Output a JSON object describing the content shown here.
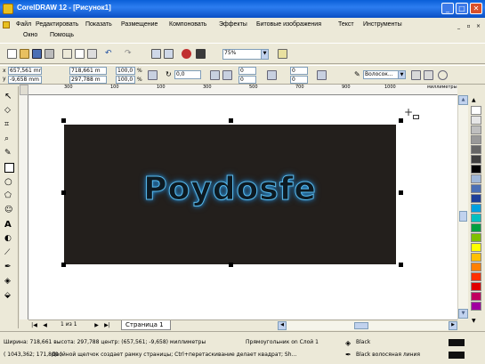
{
  "window": {
    "title": "CorelDRAW 12 - [Рисунок1]"
  },
  "menu": {
    "row1": [
      "Файл",
      "Редактировать",
      "Показать",
      "Размещение",
      "Компоновать",
      "Эффекты",
      "Битовые изображения",
      "Текст",
      "Инструменты"
    ],
    "row2": [
      "Окно",
      "Помощь"
    ]
  },
  "toolbar": {
    "zoom_value": "75%"
  },
  "property_bar": {
    "x_value": "657,561 mm",
    "y_value": "-9,658 mm",
    "width_value": "718,661 m",
    "height_value": "297,788 m",
    "scale_x": "100,0",
    "scale_y": "100,0",
    "scale_unit": "%",
    "rotation": "0,0",
    "corner_1": "0",
    "corner_2": "0",
    "corner_3": "0",
    "corner_4": "0",
    "outline_width": "Волосок..."
  },
  "ruler": {
    "h_labels": [
      "300",
      "200",
      "100",
      "0",
      "100",
      "200",
      "300",
      "400",
      "500",
      "600",
      "700",
      "800",
      "900",
      "1000"
    ],
    "unit": "миллиметры"
  },
  "canvas": {
    "logo_text": "Poydosfe"
  },
  "pagenav": {
    "page_count": "1 из 1",
    "page_tab": "Страница 1"
  },
  "palette": {
    "colors": [
      "#ffffff",
      "#e6e6e6",
      "#bfbfbf",
      "#999999",
      "#666666",
      "#404040",
      "#000000",
      "#9fb7d8",
      "#4a6fb5",
      "#1d3f9a",
      "#00a0e0",
      "#00c0c0",
      "#00a040",
      "#80c000",
      "#ffff00",
      "#ffc000",
      "#ff8000",
      "#ff3000",
      "#e00000",
      "#c00060",
      "#a000a0"
    ]
  },
  "status": {
    "dimensions": "Ширина: 718,661 высота: 297,788 центр: (657,561; -9,658) миллиметры",
    "object_info": "Прямоугольник on Слой 1",
    "coords": "( 1043,362; 171,800 )",
    "hint": "Двойной щелчок создает рамку страницы; Ctrl+перетаскивание делает квадрат; Sh...",
    "fill_label": "Black",
    "outline_label": "Black  волосяная линия"
  }
}
